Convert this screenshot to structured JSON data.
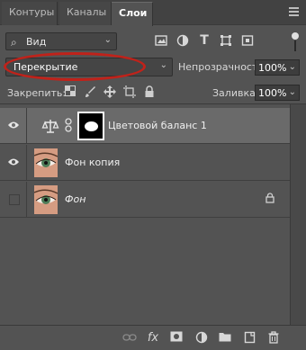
{
  "tabs": [
    {
      "label": "Контуры"
    },
    {
      "label": "Каналы"
    },
    {
      "label": "Слои"
    }
  ],
  "filter": {
    "label": "Вид"
  },
  "blend": {
    "mode": "Перекрытие",
    "opacity_label": "Непрозрачность:",
    "opacity_value": "100%"
  },
  "lock": {
    "label": "Закрепить:",
    "fill_label": "Заливка:",
    "fill_value": "100%"
  },
  "layers": [
    {
      "name": "Цветовой баланс 1",
      "visible": true,
      "selected": true,
      "type": "adjustment"
    },
    {
      "name": "Фон копия",
      "visible": true,
      "selected": false,
      "type": "image"
    },
    {
      "name": "Фон",
      "visible": false,
      "selected": false,
      "type": "image",
      "locked": true
    }
  ],
  "colors": {
    "panel": "#535353",
    "tabbar": "#424242",
    "selected_row": "#6a6a6a",
    "annotation": "#c0221a"
  }
}
